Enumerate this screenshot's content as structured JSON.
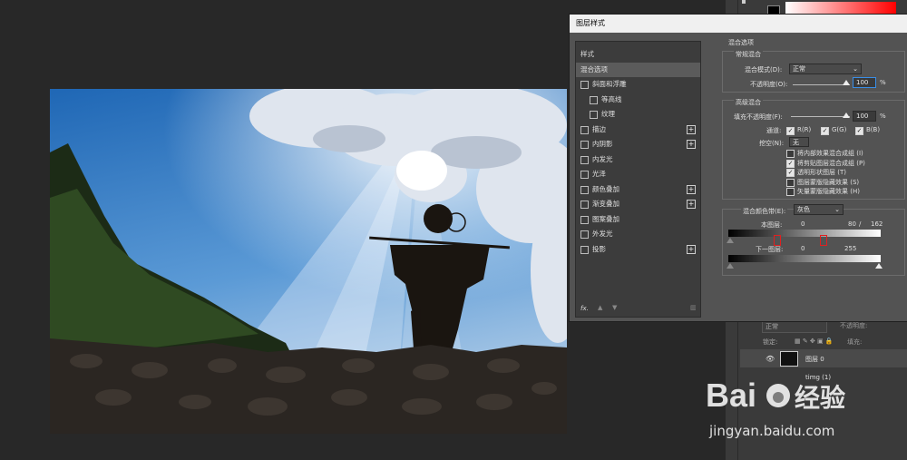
{
  "dialog": {
    "title": "图层样式",
    "style_list": [
      {
        "label": "样式",
        "check": false,
        "plus": false,
        "selected": false,
        "indent": 0
      },
      {
        "label": "混合选项",
        "check": false,
        "plus": false,
        "selected": true,
        "indent": 0
      },
      {
        "label": "斜面和浮雕",
        "check": true,
        "plus": false,
        "selected": false,
        "indent": 0
      },
      {
        "label": "等高线",
        "check": true,
        "plus": false,
        "selected": false,
        "indent": 1
      },
      {
        "label": "纹理",
        "check": true,
        "plus": false,
        "selected": false,
        "indent": 1
      },
      {
        "label": "描边",
        "check": true,
        "plus": true,
        "selected": false,
        "indent": 0
      },
      {
        "label": "内阴影",
        "check": true,
        "plus": true,
        "selected": false,
        "indent": 0
      },
      {
        "label": "内发光",
        "check": true,
        "plus": false,
        "selected": false,
        "indent": 0
      },
      {
        "label": "光泽",
        "check": true,
        "plus": false,
        "selected": false,
        "indent": 0
      },
      {
        "label": "颜色叠加",
        "check": true,
        "plus": true,
        "selected": false,
        "indent": 0
      },
      {
        "label": "渐变叠加",
        "check": true,
        "plus": true,
        "selected": false,
        "indent": 0
      },
      {
        "label": "图案叠加",
        "check": true,
        "plus": false,
        "selected": false,
        "indent": 0
      },
      {
        "label": "外发光",
        "check": true,
        "plus": false,
        "selected": false,
        "indent": 0
      },
      {
        "label": "投影",
        "check": true,
        "plus": true,
        "selected": false,
        "indent": 0
      }
    ],
    "fx_label": "fx.",
    "blend_options": {
      "heading": "混合选项",
      "general": {
        "heading": "常规混合",
        "mode_label": "混合模式(D):",
        "mode_value": "正常",
        "opacity_label": "不透明度(O):",
        "opacity_value": "100",
        "percent": "%"
      },
      "advanced": {
        "heading": "高级混合",
        "fill_label": "填充不透明度(F):",
        "fill_value": "100",
        "percent": "%",
        "channels_label": "通道:",
        "channel_r": "R(R)",
        "channel_g": "G(G)",
        "channel_b": "B(B)",
        "knockout_label": "挖空(N):",
        "knockout_value": "无",
        "options": [
          {
            "label": "将内部效果混合成组 (I)",
            "checked": false
          },
          {
            "label": "将剪贴图层混合成组 (P)",
            "checked": true
          },
          {
            "label": "透明形状图层 (T)",
            "checked": true
          },
          {
            "label": "图层蒙版隐藏效果 (S)",
            "checked": false
          },
          {
            "label": "矢量蒙版隐藏效果 (H)",
            "checked": false
          }
        ]
      },
      "blend_if": {
        "label": "混合颜色带(E):",
        "value": "灰色",
        "this_layer_label": "本图层:",
        "this_layer_values": [
          "0",
          "80",
          "/",
          "162"
        ],
        "under_layer_label": "下一图层:",
        "under_layer_values": [
          "0",
          "255"
        ]
      }
    }
  },
  "layers_panel": {
    "mode": "正常",
    "opacity_label": "不透明度:",
    "lock_label": "锁定:",
    "fill_label": "填充:",
    "layers": [
      {
        "name": "图层 0"
      },
      {
        "name": "timg (1)"
      }
    ]
  },
  "watermark": {
    "brand": "Bai",
    "brand_cn": "经验",
    "url": "jingyan.baidu.com"
  },
  "colors": {
    "dialog_bg": "#535353",
    "highlight_red": "#e02020",
    "sky_blue": "#2f79c4"
  }
}
